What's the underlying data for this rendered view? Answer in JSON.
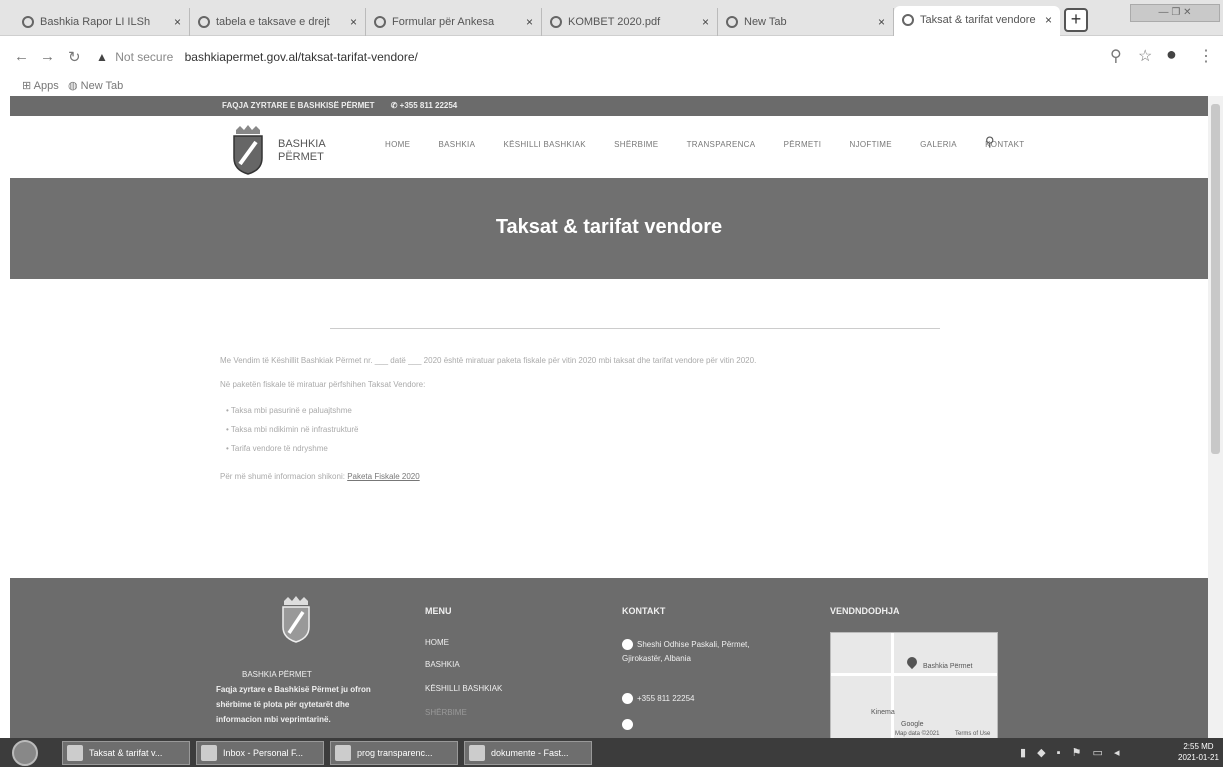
{
  "browser": {
    "tabs": [
      {
        "label": "Bashkia Rapor LI ILSh"
      },
      {
        "label": "tabela e taksave e drejt"
      },
      {
        "label": "Formular për Ankesa"
      },
      {
        "label": "KOMBET 2020.pdf"
      },
      {
        "label": "New Tab"
      },
      {
        "label": "Taksat & tarifat vendore"
      }
    ],
    "new_tab": "+",
    "address": {
      "security": "Not secure",
      "url": "bashkiapermet.gov.al/taksat-tarifat-vendore/"
    },
    "bookmarks": [
      "Apps",
      "New Tab"
    ]
  },
  "site": {
    "topbar": {
      "org": "FAQJA ZYRTARE E BASHKISË PËRMET",
      "phone": "+355 811 22254"
    },
    "logo_text": {
      "line1": "BASHKIA",
      "line2": "PËRMET"
    },
    "menu": [
      "HOME",
      "BASHKIA",
      "KËSHILLI BASHKIAK",
      "SHËRBIME",
      "TRANSPARENCA",
      "PËRMETI",
      "NJOFTIME",
      "GALERIA",
      "KONTAKT"
    ],
    "hero_title": "Taksat & tarifat vendore",
    "content": {
      "p1": "Me Vendim të Këshillit Bashkiak Përmet nr. ___ datë ___ 2020 është miratuar paketa fiskale për vitin 2020 mbi taksat dhe tarifat vendore për vitin 2020.",
      "p2": "Në paketën fiskale të miratuar përfshihen Taksat Vendore:",
      "bullets": [
        "Taksa mbi pasurinë e paluajtshme",
        "Taksa mbi ndikimin në infrastrukturë",
        "Tarifa vendore të ndryshme"
      ],
      "p3_prefix": "Për më shumë informacion shikoni:",
      "p3_link": "Paketa Fiskale 2020"
    },
    "footer": {
      "brand_name": "BASHKIA PËRMET",
      "description": "Faqja zyrtare e Bashkisë Përmet ju ofron shërbime të plota për qytetarët dhe informacion mbi veprimtarinë.",
      "menu_title": "MENU",
      "menu_items": [
        "HOME",
        "BASHKIA",
        "KËSHILLI BASHKIAK",
        "SHËRBIME"
      ],
      "contact_title": "KONTAKT",
      "address": "Sheshi Odhise Paskali, Përmet, Gjirokastër, Albania",
      "phone": "+355 811 22254",
      "location_title": "VENDNDODHJA",
      "map_labels": [
        "Bashkia Përmet",
        "Kinema",
        "Google",
        "Map data ©2021",
        "Terms of Use"
      ]
    }
  },
  "taskbar": {
    "items": [
      "Taksat & tarifat v...",
      "Inbox - Personal F...",
      "prog transparenc...",
      "dokumente - Fast..."
    ],
    "clock_time": "2:55 MD",
    "clock_date": "2021-01-21"
  },
  "colors": {
    "hero_bg": "#707070",
    "footer_bg": "#6c6c6c",
    "topbar_bg": "#6b6b6b"
  }
}
